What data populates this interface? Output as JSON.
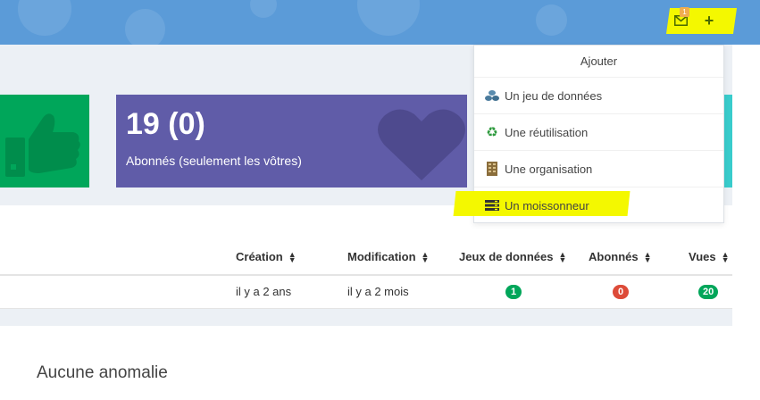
{
  "topbar": {
    "bg_color": "#5b9bd8",
    "mail_icon": "envelope-icon",
    "mail_badge": "1",
    "plus_icon": "plus-icon",
    "plus_glyph": "+"
  },
  "stats": [
    {
      "icon": "thumbs-up-icon",
      "color": "#00a65a"
    },
    {
      "count": "19 (0)",
      "label": "Abonnés (seulement les vôtres)",
      "icon": "heart-icon",
      "color": "#605ca8"
    },
    {
      "color": "#39cccc"
    }
  ],
  "dropdown": {
    "header": "Ajouter",
    "items": [
      {
        "label": "Un jeu de données",
        "icon": "datasets-icon"
      },
      {
        "label": "Une réutilisation",
        "icon": "recycle-icon"
      },
      {
        "label": "Une organisation",
        "icon": "building-icon"
      },
      {
        "label": "Un moissonneur",
        "icon": "harvester-icon",
        "highlighted": true
      }
    ]
  },
  "table": {
    "columns": [
      "Création",
      "Modification",
      "Jeux de données",
      "Abonnés",
      "Vues"
    ],
    "rows": [
      {
        "creation": "il y a 2 ans",
        "modification": "il y a 2 mois",
        "datasets": "1",
        "followers": "0",
        "views": "20"
      }
    ],
    "pill_colors": {
      "datasets": "#00a65a",
      "followers": "#dd4b39",
      "views": "#00a65a"
    }
  },
  "anomaly_text": "Aucune anomalie",
  "highlight_color": "#f4f800"
}
